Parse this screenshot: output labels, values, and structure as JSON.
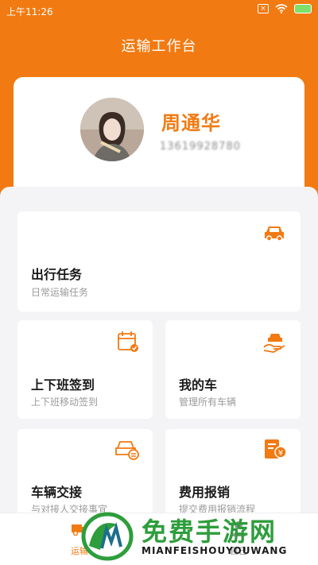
{
  "status_bar": {
    "time": "上午11:26",
    "notification_icon": "x-box-icon",
    "wifi_icon": "wifi-icon",
    "battery_icon": "battery-charging-icon"
  },
  "header": {
    "title": "运输工作台"
  },
  "profile": {
    "name": "周通华",
    "phone": "13619928780"
  },
  "cards": {
    "trip": {
      "title": "出行任务",
      "subtitle": "日常运输任务",
      "icon": "car-icon"
    },
    "checkin": {
      "title": "上下班签到",
      "subtitle": "上下班移动签到",
      "icon": "calendar-check-icon"
    },
    "my_car": {
      "title": "我的车",
      "subtitle": "管理所有车辆",
      "icon": "car-in-hand-icon"
    },
    "handover": {
      "title": "车辆交接",
      "subtitle": "与对接人交接事宜",
      "icon": "car-exchange-icon"
    },
    "expense": {
      "title": "费用报销",
      "subtitle": "提交费用报销流程",
      "icon": "receipt-yen-icon"
    }
  },
  "tabbar": {
    "transport": "运输",
    "me": "自己"
  },
  "watermark": {
    "text": "免费手游网",
    "sub": "MIANFEISHOUYOUWANG"
  },
  "colors": {
    "accent": "#f27a12",
    "background": "#f4f4f6",
    "watermark_green": "#2e9d3c"
  }
}
